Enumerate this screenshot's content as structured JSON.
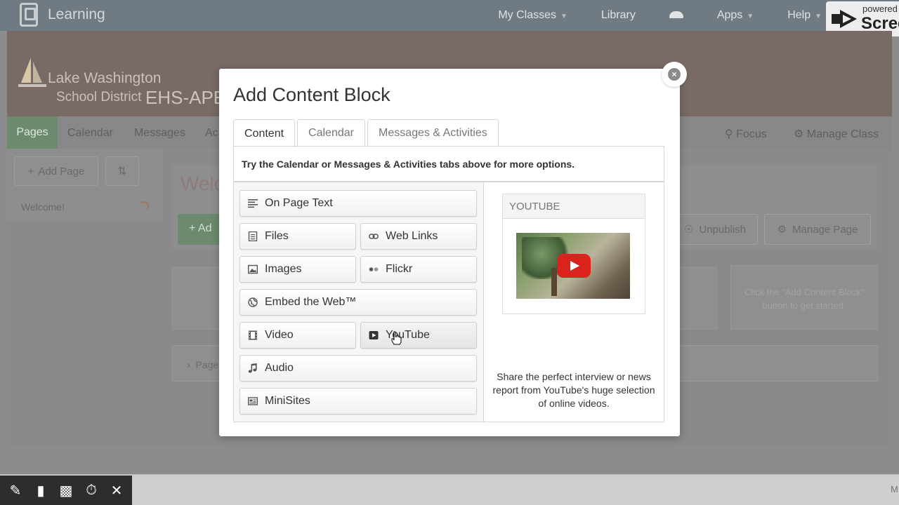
{
  "topbar": {
    "brand": "Learning",
    "nav": [
      {
        "label": "My Classes",
        "caret": true
      },
      {
        "label": "Library",
        "caret": false
      },
      {
        "label": "",
        "icon": "cloud-icon"
      },
      {
        "label": "Apps",
        "caret": true
      },
      {
        "label": "Help",
        "caret": true
      }
    ],
    "powered_text": "powered",
    "powered_brand": "Scree"
  },
  "district": {
    "line1": "Lake Washington",
    "line2": "School District"
  },
  "class_title": "EHS-APE",
  "classnav": {
    "pages": "Pages",
    "items": [
      "Calendar",
      "Messages",
      "Ac"
    ],
    "focus": "Focus",
    "manage_class": "Manage Class"
  },
  "sidebar": {
    "add_page": "Add Page",
    "welcome": "Welcome!"
  },
  "main": {
    "page_title": "Welc",
    "add_btn": "Ad",
    "unpublish": "Unpublish",
    "manage_page": "Manage Page",
    "hint": "Click the \"Add Content Block\" button to get started.",
    "pages_row": "Page"
  },
  "modal": {
    "title": "Add Content Block",
    "tabs": [
      "Content",
      "Calendar",
      "Messages & Activities"
    ],
    "tip": "Try the Calendar or Messages & Activities tabs above for more options.",
    "buttons": {
      "on_page_text": "On Page Text",
      "files": "Files",
      "web_links": "Web Links",
      "images": "Images",
      "flickr": "Flickr",
      "embed": "Embed the Web™",
      "video": "Video",
      "youtube": "YouTube",
      "audio": "Audio",
      "minisites": "MiniSites"
    },
    "preview": {
      "heading": "YOUTUBE",
      "description": "Share the perfect interview or news report from YouTube's huge selection of online videos."
    }
  },
  "colors": {
    "accent_green": "#6d8a6f",
    "youtube_red": "#d9231c"
  }
}
